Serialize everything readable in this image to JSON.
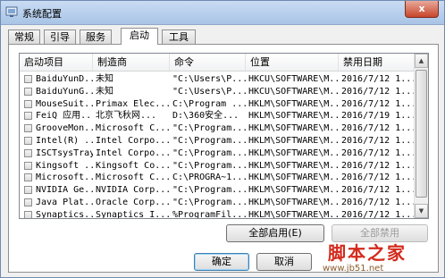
{
  "window": {
    "title": "系统配置",
    "close_label": "x"
  },
  "tabs": [
    {
      "label": "常规",
      "active": false
    },
    {
      "label": "引导",
      "active": false
    },
    {
      "label": "服务",
      "active": false
    },
    {
      "label": "启动",
      "active": true
    },
    {
      "label": "工具",
      "active": false
    }
  ],
  "table": {
    "headers": [
      "启动项目",
      "制造商",
      "命令",
      "位置",
      "禁用日期"
    ],
    "rows": [
      [
        "BaiduYunD...",
        "未知",
        "\"C:\\Users\\P...",
        "HKCU\\SOFTWARE\\M...",
        "2016/7/12 1..."
      ],
      [
        "BaiduYunG...",
        "未知",
        "\"C:\\Users\\P...",
        "HKCU\\SOFTWARE\\M...",
        "2016/7/12 1..."
      ],
      [
        "MouseSuit...",
        "Primax Elec...",
        "C:\\Program ...",
        "HKLM\\SOFTWARE\\M...",
        "2016/7/12 1..."
      ],
      [
        "FeiQ 应用...",
        "北京飞秋网...",
        "D:\\360安全...",
        "HKLM\\SOFTWARE\\M...",
        "2016/7/19 1..."
      ],
      [
        "GrooveMon...",
        "Microsoft C...",
        "\"C:\\Program...",
        "HKLM\\SOFTWARE\\M...",
        "2016/7/12 1..."
      ],
      [
        "Intel(R) ...",
        "Intel Corpo...",
        "\"C:\\Program...",
        "HKLM\\SOFTWARE\\M...",
        "2016/7/12 1..."
      ],
      [
        "ISCTsysTray",
        "Intel Corpo...",
        "\"C:\\Program...",
        "HKLM\\SOFTWARE\\M...",
        "2016/7/12 1..."
      ],
      [
        "Kingsoft ...",
        "Kingsoft Co...",
        "\"C:\\Program...",
        "HKLM\\SOFTWARE\\M...",
        "2016/7/12 1..."
      ],
      [
        "Microsoft...",
        "Microsoft C...",
        "C:\\PROGRA~1...",
        "HKLM\\SOFTWARE\\M...",
        "2016/7/12 1..."
      ],
      [
        "NVIDIA Ge...",
        "NVIDIA Corp...",
        "\"C:\\Program...",
        "HKLM\\SOFTWARE\\M...",
        "2016/7/12 1..."
      ],
      [
        "Java Plat...",
        "Oracle Corp...",
        "\"C:\\Program...",
        "HKLM\\SOFTWARE\\M...",
        "2016/7/12 1..."
      ],
      [
        "Synaptics...",
        "Synaptics I...",
        "%ProgramFil...",
        "HKLM\\SOFTWARE\\M...",
        "2016/7/12 1..."
      ]
    ]
  },
  "buttons": {
    "enable_all": "全部启用(E)",
    "disable_all": "全部禁用",
    "ok": "确定",
    "cancel": "取消"
  },
  "watermark": {
    "logo": "脚本之家",
    "url": "www.jb51.net"
  }
}
